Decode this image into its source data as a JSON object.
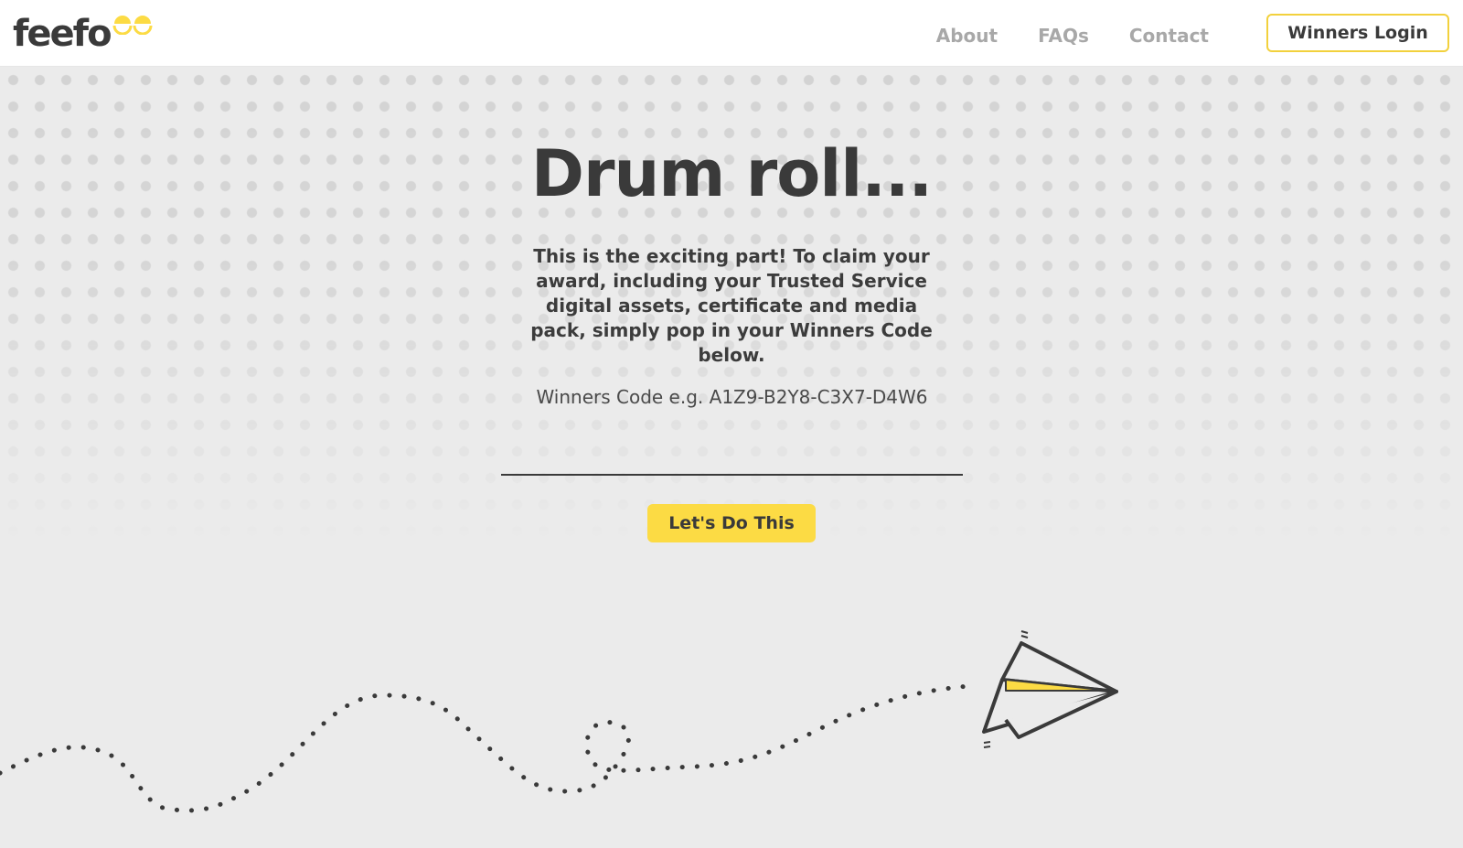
{
  "brand": {
    "name": "feefo",
    "accent_color": "#fcdb44",
    "logo_icon": "feefo-eyes-icon"
  },
  "nav": {
    "items": [
      "About",
      "FAQs",
      "Contact"
    ],
    "login_label": "Winners Login"
  },
  "hero": {
    "title": "Drum roll...",
    "description": "This is the exciting part! To claim your award, including your Trusted Service digital assets, certificate and media pack, simply pop in your Winners Code below."
  },
  "form": {
    "code_label": "Winners Code e.g. A1Z9-B2Y8-C3X7-D4W6",
    "code_value": "",
    "submit_label": "Let's Do This"
  },
  "illustration": {
    "icon": "paper-plane-icon"
  }
}
